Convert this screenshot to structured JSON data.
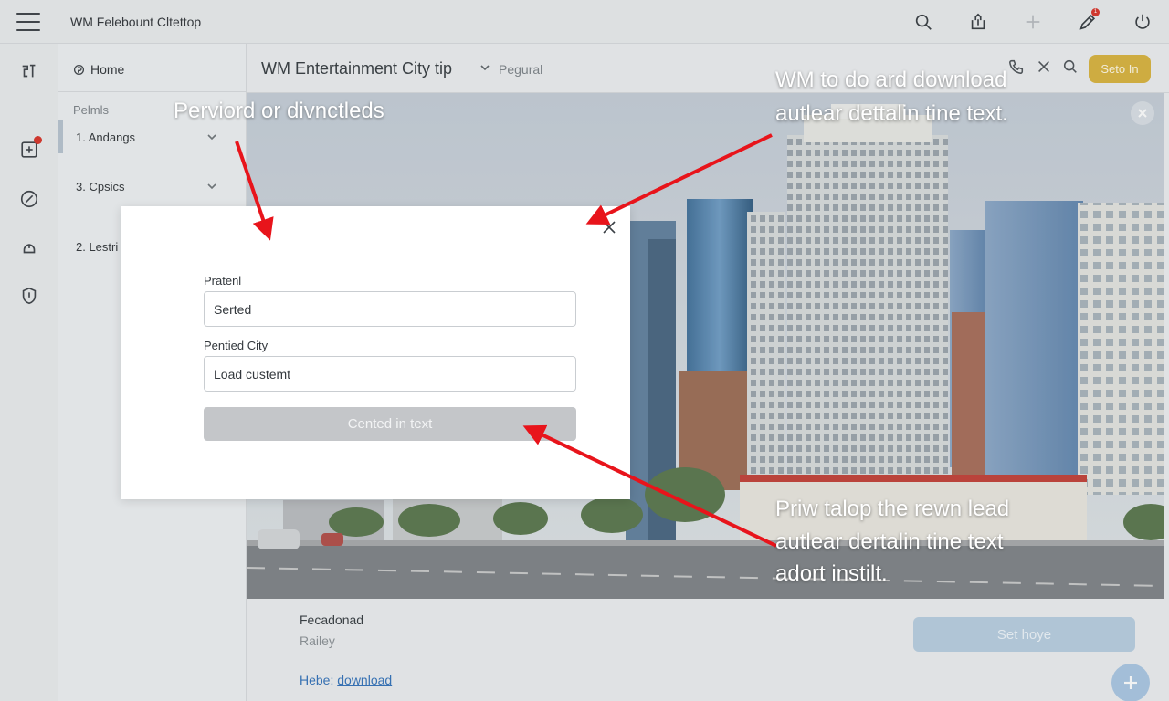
{
  "app": {
    "title": "WM Felebount Cltettop"
  },
  "topbar": {
    "icons": [
      "search-icon",
      "share-icon",
      "plus-icon",
      "edit-icon",
      "power-icon"
    ],
    "notification_badge": "1"
  },
  "rail": {
    "icons": [
      "panel-icon",
      "grid-icon",
      "compass-icon",
      "alert-icon",
      "shield-icon"
    ]
  },
  "sidebar": {
    "home_label": "Home",
    "section_label": "Pelmls",
    "items": [
      {
        "label": "1.  Andangs"
      },
      {
        "label": "3.  Cpsics"
      },
      {
        "label": "2.  Lestri"
      }
    ]
  },
  "header": {
    "title": "WM Entertainment City tip",
    "sub_label": "Pegural",
    "signin_label": "Seto In"
  },
  "modal": {
    "field1_label": "Pratenl",
    "field1_value": "Serted",
    "field2_label": "Pentied City",
    "field2_value": "Load custemt",
    "button_label": "Cented in text"
  },
  "lower": {
    "title": "Fecadonad",
    "subtitle": "Railey",
    "help_prefix": "Hebe: ",
    "help_link": "download",
    "set_home_label": "Set hoye"
  },
  "annotations": {
    "a1": "Perviord or divnctleds",
    "a2_line1": "WM to do ard download",
    "a2_line2": "autlear dettalin tine text.",
    "a3_line1": "Priw talop the rewn lead",
    "a3_line2": "autlear dertalin tine text",
    "a3_line3": "adort instilt."
  },
  "colors": {
    "annotation_arrow": "#e8141b",
    "signin_button": "#d8b23a",
    "set_home_button": "#b7cde0",
    "link": "#2f6fb8"
  }
}
